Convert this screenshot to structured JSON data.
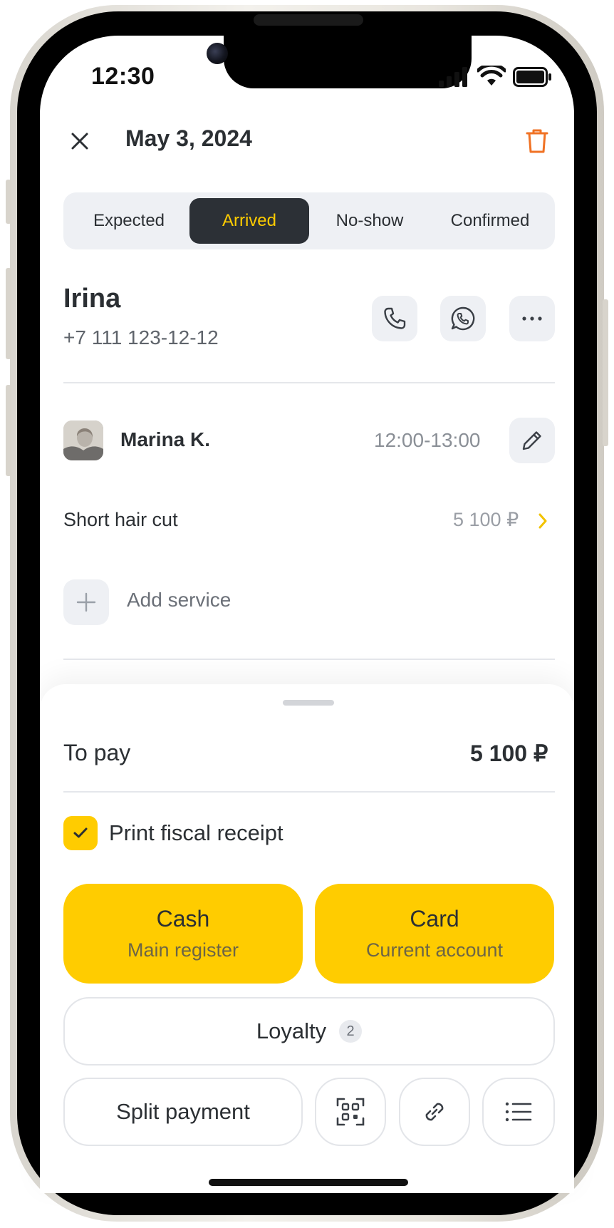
{
  "status_bar": {
    "time": "12:30"
  },
  "header": {
    "date": "May 3, 2024"
  },
  "status_tabs": [
    {
      "label": "Expected",
      "active": false
    },
    {
      "label": "Arrived",
      "active": true
    },
    {
      "label": "No-show",
      "active": false
    },
    {
      "label": "Confirmed",
      "active": false
    }
  ],
  "client": {
    "name": "Irina",
    "phone": "+7 111 123-12-12"
  },
  "master": {
    "name": "Marina K.",
    "time": "12:00-13:00"
  },
  "service": {
    "name": "Short hair cut",
    "price": "5 100 ₽"
  },
  "add_service": {
    "label": "Add service"
  },
  "payment": {
    "to_pay_label": "To pay",
    "to_pay_value": "5 100 ₽",
    "receipt_label": "Print fiscal receipt",
    "receipt_checked": true,
    "cash": {
      "title": "Cash",
      "subtitle": "Main register"
    },
    "card": {
      "title": "Card",
      "subtitle": "Current account"
    },
    "loyalty": {
      "label": "Loyalty",
      "count": "2"
    },
    "split_label": "Split payment"
  },
  "colors": {
    "accent": "#ffcc00",
    "dark": "#2c3036",
    "danger": "#f07224"
  },
  "icons": [
    "close-icon",
    "trash-icon",
    "phone-icon",
    "whatsapp-icon",
    "more-icon",
    "pencil-icon",
    "chevron-right-icon",
    "plus-icon",
    "check-icon",
    "qr-code-icon",
    "link-icon",
    "list-icon"
  ]
}
